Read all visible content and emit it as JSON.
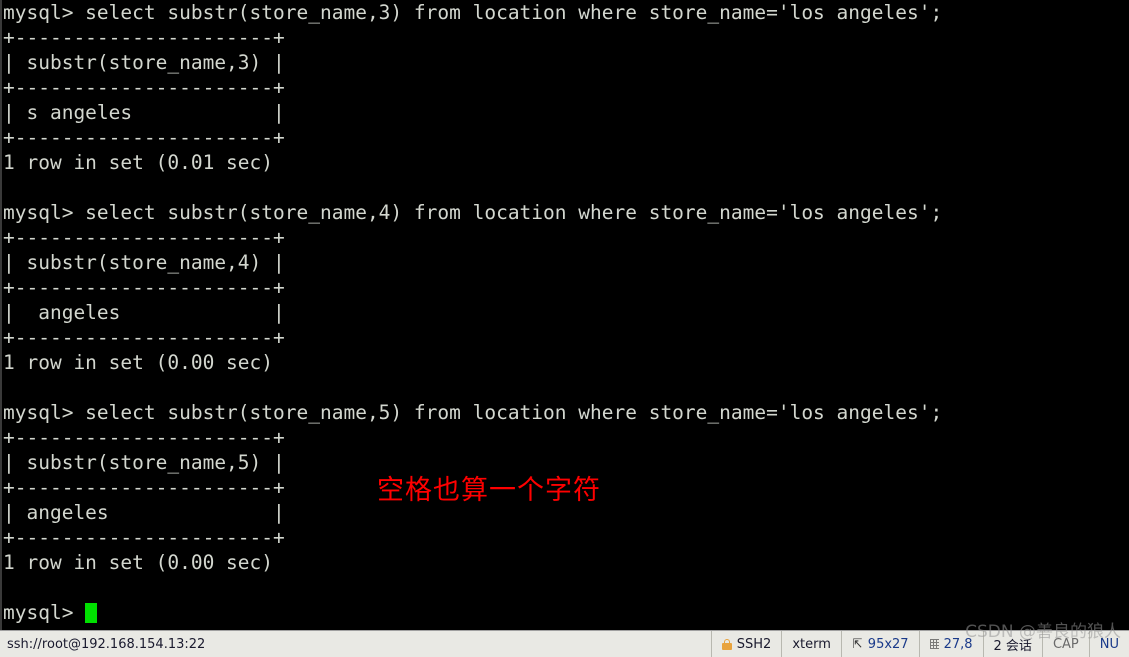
{
  "terminal": {
    "lines": [
      "mysql> select substr(store_name,3) from location where store_name='los angeles';",
      "+----------------------+",
      "| substr(store_name,3) |",
      "+----------------------+",
      "| s angeles            |",
      "+----------------------+",
      "1 row in set (0.01 sec)",
      "",
      "mysql> select substr(store_name,4) from location where store_name='los angeles';",
      "+----------------------+",
      "| substr(store_name,4) |",
      "+----------------------+",
      "|  angeles             |",
      "+----------------------+",
      "1 row in set (0.00 sec)",
      "",
      "mysql> select substr(store_name,5) from location where store_name='los angeles';",
      "+----------------------+",
      "| substr(store_name,5) |",
      "+----------------------+",
      "| angeles              |",
      "+----------------------+",
      "1 row in set (0.00 sec)",
      ""
    ],
    "prompt": "mysql> ",
    "cursor_color": "#00e000",
    "foreground_color": "#d3d7cf",
    "background_color": "#000000"
  },
  "annotation": {
    "text": "空格也算一个字符",
    "color": "#ff0000"
  },
  "watermark": {
    "text": "CSDN @善良的狼人"
  },
  "statusbar": {
    "connection": "ssh://root@192.168.154.13:22",
    "protocol": "SSH2",
    "terminal_type": "xterm",
    "dimensions": "95x27",
    "cursor_position": "27,8",
    "sessions": "2 会话",
    "caps": "CAP",
    "num": "NU"
  }
}
